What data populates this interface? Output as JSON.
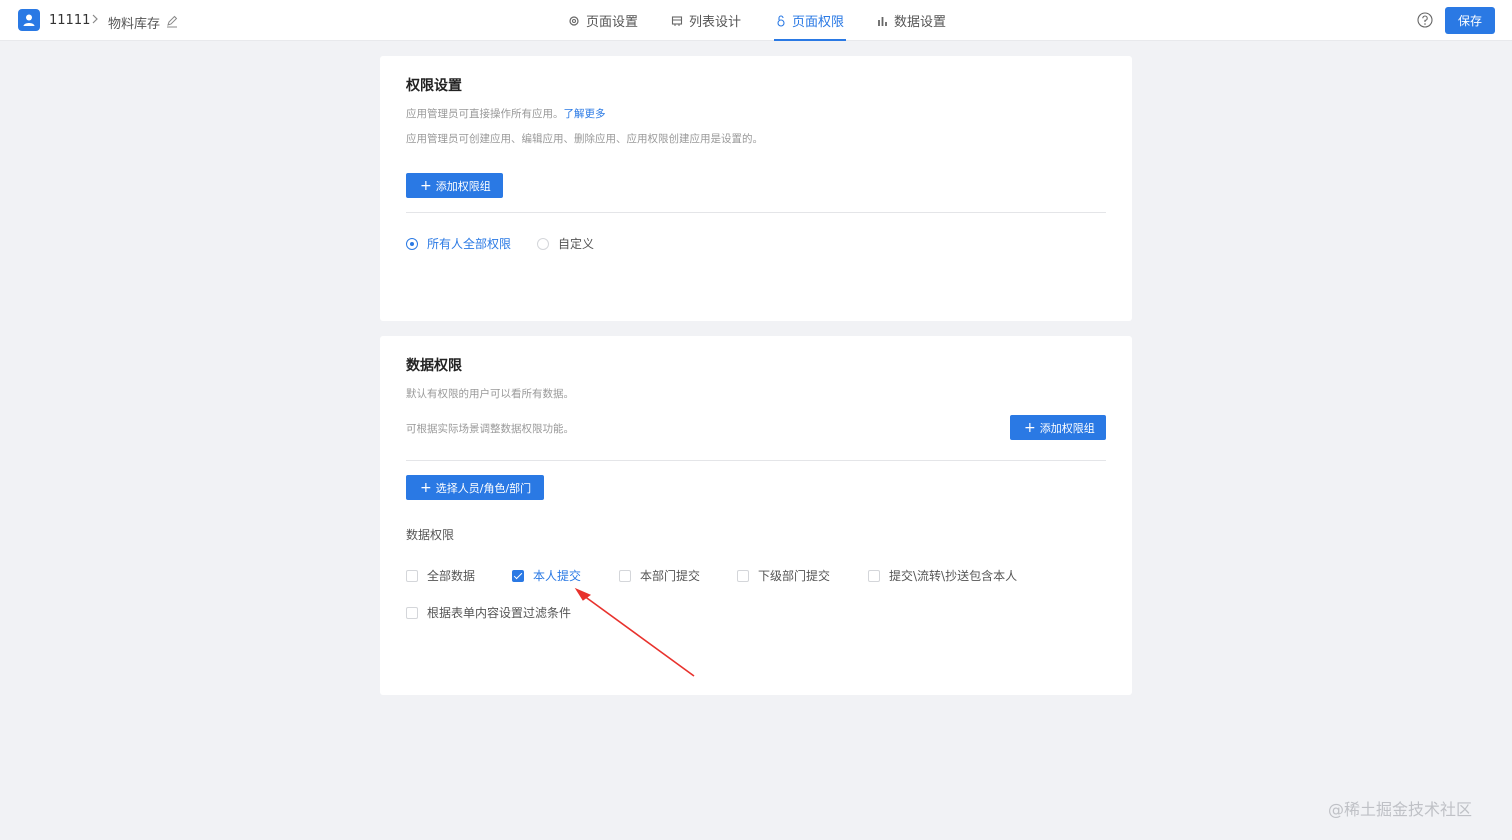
{
  "header": {
    "app_name": "11111",
    "breadcrumb_separator": ">",
    "page_name": "物料库存",
    "tabs": [
      {
        "label": "页面设置",
        "icon": "gear-icon"
      },
      {
        "label": "列表设计",
        "icon": "table-icon"
      },
      {
        "label": "页面权限",
        "icon": "lock-icon",
        "active": true
      },
      {
        "label": "数据设置",
        "icon": "chart-icon"
      }
    ],
    "save_label": "保存"
  },
  "permission": {
    "title": "权限设置",
    "desc1": "应用管理员可直接操作所有应用。",
    "desc1_link": "了解更多",
    "desc2": "应用管理员可创建应用、编辑应用、删除应用、应用权限创建应用是设置的。",
    "add_group_label": "添加权限组",
    "options": [
      {
        "label": "所有人全部权限",
        "checked": true
      },
      {
        "label": "自定义",
        "checked": false
      }
    ]
  },
  "data_permission": {
    "title": "数据权限",
    "desc1": "默认有权限的用户可以看所有数据。",
    "desc2": "可根据实际场景调整数据权限功能。",
    "add_group_label": "添加权限组",
    "select_label": "选择人员/角色/部门",
    "section_label": "数据权限",
    "checkboxes": [
      {
        "label": "全部数据",
        "checked": false
      },
      {
        "label": "本人提交",
        "checked": true
      },
      {
        "label": "本部门提交",
        "checked": false
      },
      {
        "label": "下级部门提交",
        "checked": false
      },
      {
        "label": "提交\\流转\\抄送包含本人",
        "checked": false
      },
      {
        "label": "根据表单内容设置过滤条件",
        "checked": false
      }
    ]
  },
  "watermark": "@稀土掘金技术社区",
  "colors": {
    "accent": "#2a79e4",
    "arrow": "#e8322d"
  }
}
